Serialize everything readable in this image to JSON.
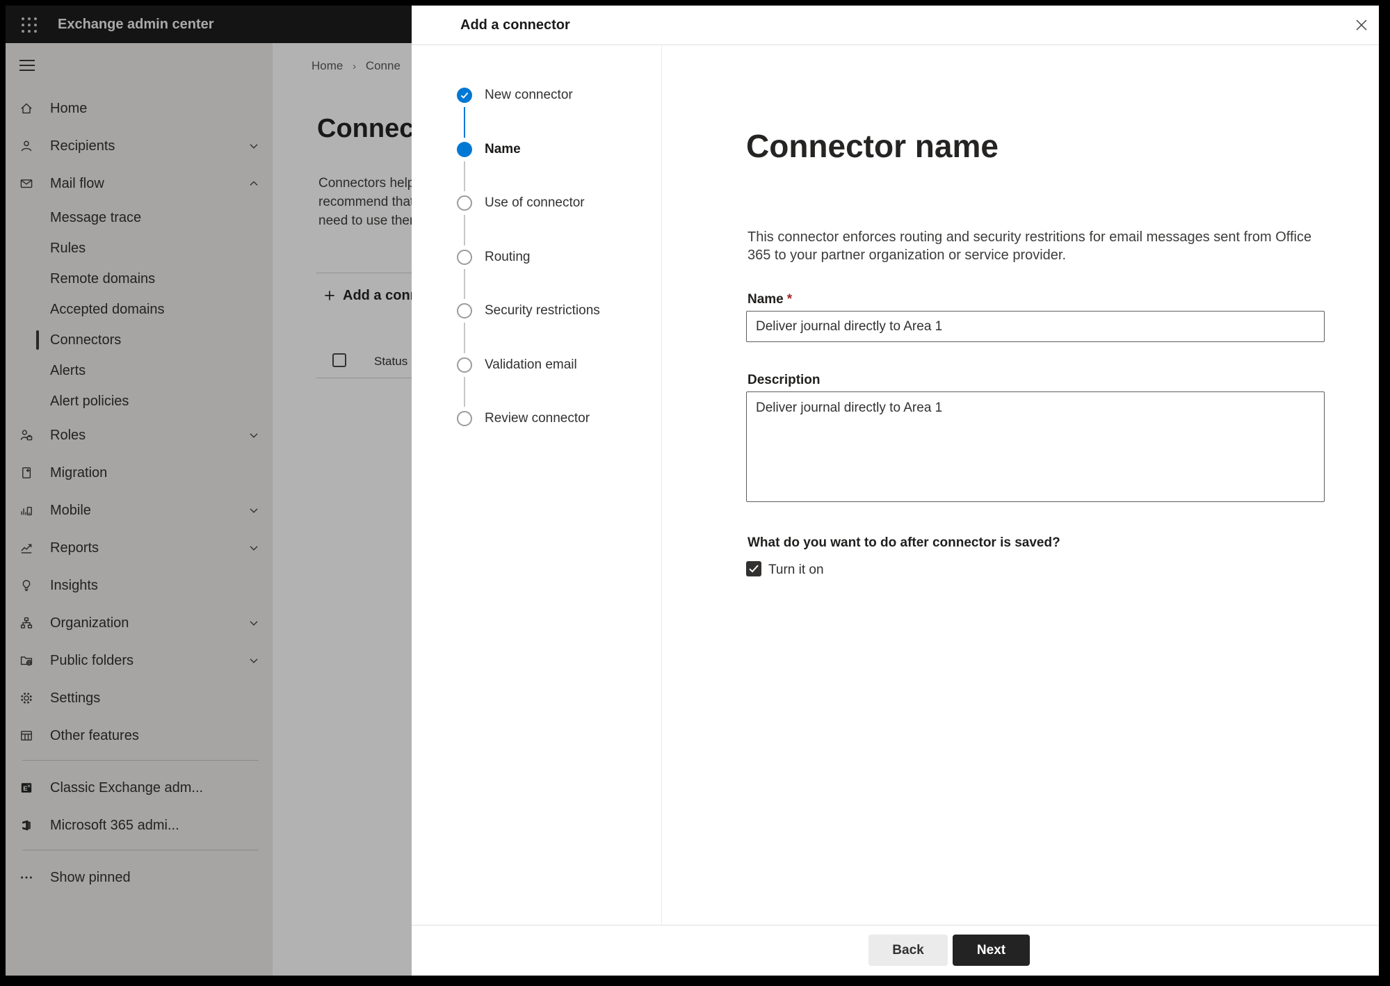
{
  "topbar": {
    "app_title": "Exchange admin center"
  },
  "sidebar": {
    "items": [
      {
        "label": "Home",
        "icon": "home-icon",
        "level": "top"
      },
      {
        "label": "Recipients",
        "icon": "person-icon",
        "level": "top",
        "chevron": "down"
      },
      {
        "label": "Mail flow",
        "icon": "mail-icon",
        "level": "top",
        "chevron": "up",
        "expanded": true
      },
      {
        "label": "Message trace",
        "level": "sub"
      },
      {
        "label": "Rules",
        "level": "sub"
      },
      {
        "label": "Remote domains",
        "level": "sub"
      },
      {
        "label": "Accepted domains",
        "level": "sub"
      },
      {
        "label": "Connectors",
        "level": "sub",
        "selected": true
      },
      {
        "label": "Alerts",
        "level": "sub"
      },
      {
        "label": "Alert policies",
        "level": "sub"
      },
      {
        "label": "Roles",
        "icon": "person-badge-icon",
        "level": "top",
        "chevron": "down"
      },
      {
        "label": "Migration",
        "icon": "document-arrow-icon",
        "level": "top"
      },
      {
        "label": "Mobile",
        "icon": "chart-phone-icon",
        "level": "top",
        "chevron": "down"
      },
      {
        "label": "Reports",
        "icon": "line-chart-icon",
        "level": "top",
        "chevron": "down"
      },
      {
        "label": "Insights",
        "icon": "lightbulb-icon",
        "level": "top"
      },
      {
        "label": "Organization",
        "icon": "org-chart-icon",
        "level": "top",
        "chevron": "down"
      },
      {
        "label": "Public folders",
        "icon": "folder-globe-icon",
        "level": "top",
        "chevron": "down"
      },
      {
        "label": "Settings",
        "icon": "gear-icon",
        "level": "top"
      },
      {
        "label": "Other features",
        "icon": "grid-table-icon",
        "level": "top"
      },
      {
        "divider": true
      },
      {
        "label": "Classic Exchange adm...",
        "icon": "exchange-logo-icon",
        "level": "top"
      },
      {
        "label": "Microsoft 365 admi...",
        "icon": "office-logo-icon",
        "level": "top"
      },
      {
        "divider": true
      },
      {
        "label": "Show pinned",
        "icon": "ellipsis-icon",
        "level": "top"
      }
    ]
  },
  "background_page": {
    "breadcrumb": [
      "Home",
      "Conne"
    ],
    "title": "Connect",
    "body_lines": [
      "Connectors help",
      "recommend that",
      "need to use ther"
    ],
    "add_button": "Add a conn",
    "status_header": "Status",
    "select_all_checked": false
  },
  "modal": {
    "title": "Add a connector",
    "steps": [
      {
        "label": "New connector",
        "state": "completed"
      },
      {
        "label": "Name",
        "state": "current"
      },
      {
        "label": "Use of connector",
        "state": "upcoming"
      },
      {
        "label": "Routing",
        "state": "upcoming"
      },
      {
        "label": "Security restrictions",
        "state": "upcoming"
      },
      {
        "label": "Validation email",
        "state": "upcoming"
      },
      {
        "label": "Review connector",
        "state": "upcoming"
      }
    ],
    "content": {
      "heading": "Connector name",
      "description": "This connector enforces routing and security restritions for email messages sent from Office 365 to your partner organization or service provider.",
      "name_label": "Name",
      "required_mark": "*",
      "name_value": "Deliver journal directly to Area 1",
      "description_label": "Description",
      "description_value": "Deliver journal directly to Area 1",
      "after_save_question": "What do you want to do after connector is saved?",
      "turn_on_label": "Turn it on",
      "turn_on_checked": true
    },
    "footer": {
      "back_label": "Back",
      "next_label": "Next"
    }
  },
  "colors": {
    "accent": "#0078d4",
    "required_mark": "#a4262c",
    "next_button_bg": "#232323",
    "checkbox_checked_bg": "#323130"
  }
}
